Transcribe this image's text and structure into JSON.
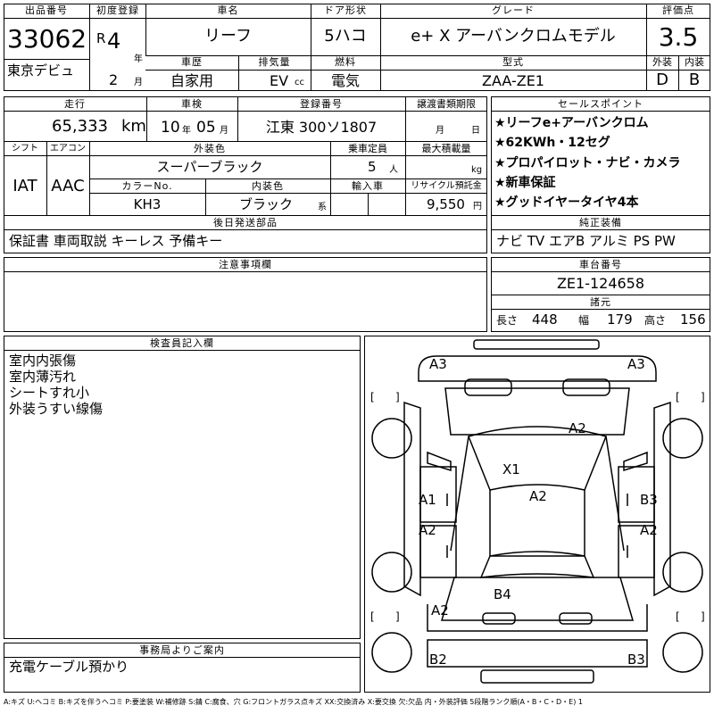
{
  "header": {
    "lot_no_label": "出品番号",
    "lot_no": "33062",
    "venue": "東京デビュ",
    "first_reg_label": "初度登録",
    "era": "R",
    "year": "4",
    "year_unit": "年",
    "month": "2",
    "month_unit": "月",
    "car_name_label": "車名",
    "car_name": "リーフ",
    "door_label": "ドア形状",
    "door": "5ハコ",
    "grade_label": "グレード",
    "grade": "e+ X アーバンクロムモデル",
    "score_label": "評価点",
    "score": "3.5",
    "history_label": "車歴",
    "history": "自家用",
    "displacement_label": "排気量",
    "displacement": "EV",
    "displacement_unit": "cc",
    "fuel_label": "燃料",
    "fuel": "電気",
    "model_label": "型式",
    "model": "ZAA-ZE1",
    "exterior_label": "外装",
    "exterior": "D",
    "interior_label": "内装",
    "interior": "B"
  },
  "row2": {
    "mileage_label": "走行",
    "mileage": "65,333",
    "mileage_unit": "km",
    "inspection_label": "車検",
    "insp_year": "10",
    "insp_year_unit": "年",
    "insp_month": "05",
    "insp_month_unit": "月",
    "plate_label": "登録番号",
    "plate": "江東 300ソ1807",
    "transfer_label": "譲渡書類期限",
    "transfer_month_unit": "月",
    "transfer_day_unit": "日",
    "shift_label": "シフト",
    "shift": "IAT",
    "aircon_label": "エアコン",
    "aircon": "AAC",
    "color_label": "外装色",
    "color": "スーパーブラック",
    "capacity_label": "乗車定員",
    "capacity": "5",
    "capacity_unit": "人",
    "load_label": "最大積載量",
    "load_unit": "kg",
    "color_no_label": "カラーNo.",
    "color_no": "KH3",
    "int_color_label": "内装色",
    "int_color": "ブラック",
    "int_color_unit": "系",
    "import_label": "輸入車",
    "recycle_label": "リサイクル預託金",
    "recycle": "9,550",
    "recycle_unit": "円",
    "later_label": "後日発送部品",
    "later": "保証書 車両取説 キーレス 予備キー"
  },
  "selling_points": {
    "label": "セールスポイント",
    "items": [
      "★リーフe+アーバンクロム",
      "★62KWh・12セグ",
      "★プロパイロット・ナビ・カメラ",
      "★新車保証",
      "★グッドイヤータイヤ4本"
    ]
  },
  "equipment": {
    "label": "純正装備",
    "value": "ナビ TV エアB アルミ PS PW"
  },
  "notes": {
    "label": "注意事項欄"
  },
  "chassis": {
    "label": "車台番号",
    "value": "ZE1-124658",
    "dims_label": "諸元",
    "length_label": "長さ",
    "length": "448",
    "width_label": "幅",
    "width": "179",
    "height_label": "高さ",
    "height": "156"
  },
  "inspector": {
    "label": "検査員記入欄",
    "lines": [
      "室内内張傷",
      "室内薄汚れ",
      "シートすれ小",
      "外装うすい線傷"
    ]
  },
  "office": {
    "label": "事務局よりご案内",
    "value": "充電ケーブル預かり"
  },
  "diagram": {
    "marks": {
      "a3_front_left": "A3",
      "a3_front_right": "A3",
      "a2_hood": "A2",
      "x1_glass": "X1",
      "a2_roof": "A2",
      "a1_left_door": "A1",
      "b3_right_door": "B3",
      "a2_left_rear_door": "A2",
      "a2_right_rear_door": "A2",
      "b4_rear": "B4",
      "a2_left_rear": "A2",
      "b2_rear_left": "B2",
      "b3_rear_right": "B3"
    }
  },
  "footer": {
    "legend": "A:キズ U:ヘコミ B:キズを伴うヘコミ P:要塗装 W:補修跡 S:錆 C:腐食、穴 G:フロントガラス点キズ XX:交換済み X:要交換 欠:欠品 内・外装評価 5段階ランク順(A・B・C・D・E) 1"
  }
}
